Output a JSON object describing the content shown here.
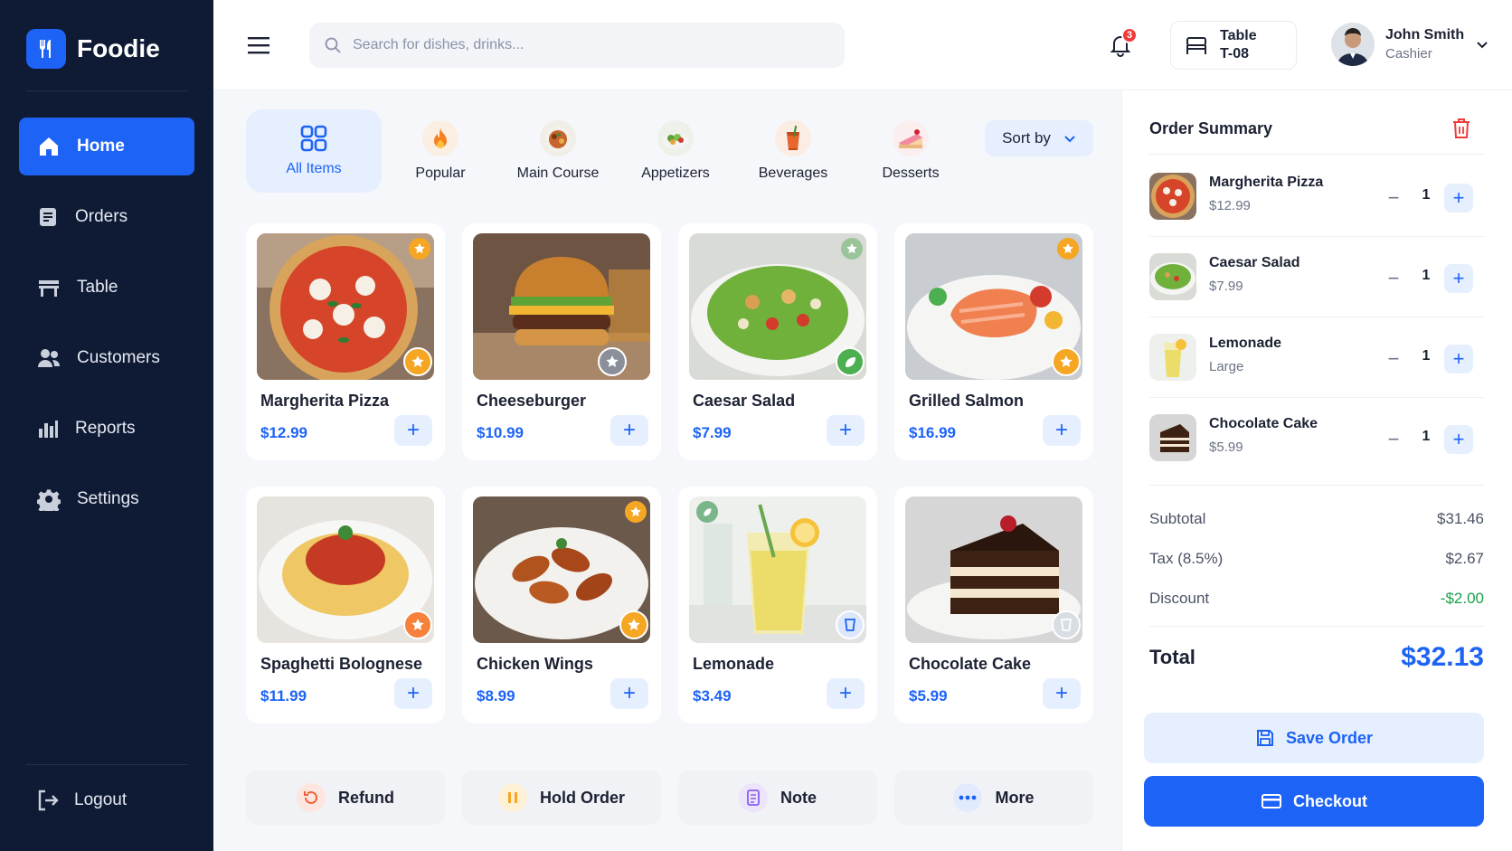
{
  "brand": {
    "name": "Foodie"
  },
  "sidebar": {
    "items": [
      {
        "label": "Home",
        "icon": "home-icon",
        "active": true
      },
      {
        "label": "Orders",
        "icon": "clipboard-icon"
      },
      {
        "label": "Table",
        "icon": "table-icon"
      },
      {
        "label": "Customers",
        "icon": "users-icon"
      },
      {
        "label": "Reports",
        "icon": "bar-chart-icon"
      },
      {
        "label": "Settings",
        "icon": "gear-icon"
      }
    ],
    "logout_label": "Logout"
  },
  "header": {
    "search_placeholder": "Search for dishes, drinks...",
    "notification_count": "3",
    "table_label": "Table",
    "table_value": "T-08",
    "user_name": "John Smith",
    "user_role": "Cashier"
  },
  "categories": [
    {
      "label": "All Items",
      "icon": "grid-icon",
      "active": true
    },
    {
      "label": "Popular",
      "icon": "fire-icon"
    },
    {
      "label": "Main Course",
      "icon": "main-course-icon"
    },
    {
      "label": "Appetizers",
      "icon": "appetizer-icon"
    },
    {
      "label": "Beverages",
      "icon": "drink-icon"
    },
    {
      "label": "Desserts",
      "icon": "cake-icon"
    }
  ],
  "sort_label": "Sort by",
  "products": [
    {
      "name": "Margherita Pizza",
      "price": "$12.99"
    },
    {
      "name": "Cheeseburger",
      "price": "$10.99"
    },
    {
      "name": "Caesar Salad",
      "price": "$7.99"
    },
    {
      "name": "Grilled Salmon",
      "price": "$16.99"
    },
    {
      "name": "Spaghetti Bolognese",
      "price": "$11.99"
    },
    {
      "name": "Chicken Wings",
      "price": "$8.99"
    },
    {
      "name": "Lemonade",
      "price": "$3.49"
    },
    {
      "name": "Chocolate Cake",
      "price": "$5.99"
    }
  ],
  "actions": [
    {
      "label": "Refund",
      "icon": "refund-icon"
    },
    {
      "label": "Hold Order",
      "icon": "pause-icon"
    },
    {
      "label": "Note",
      "icon": "note-icon"
    },
    {
      "label": "More",
      "icon": "more-icon"
    }
  ],
  "order": {
    "title": "Order Summary",
    "items": [
      {
        "name": "Margherita Pizza",
        "detail": "$12.99",
        "qty": "1"
      },
      {
        "name": "Caesar Salad",
        "detail": "$7.99",
        "qty": "1"
      },
      {
        "name": "Lemonade",
        "detail": "Large",
        "qty": "1"
      },
      {
        "name": "Chocolate Cake",
        "detail": "$5.99",
        "qty": "1"
      }
    ],
    "subtotal_label": "Subtotal",
    "subtotal": "$31.46",
    "tax_label": "Tax (8.5%)",
    "tax": "$2.67",
    "discount_label": "Discount",
    "discount": "-$2.00",
    "total_label": "Total",
    "total": "$32.13",
    "save_label": "Save Order",
    "checkout_label": "Checkout"
  },
  "colors": {
    "primary": "#1d63f5",
    "sidebar": "#0f1b35",
    "discount": "#1aa04a",
    "badge": "#ef3b3b"
  }
}
